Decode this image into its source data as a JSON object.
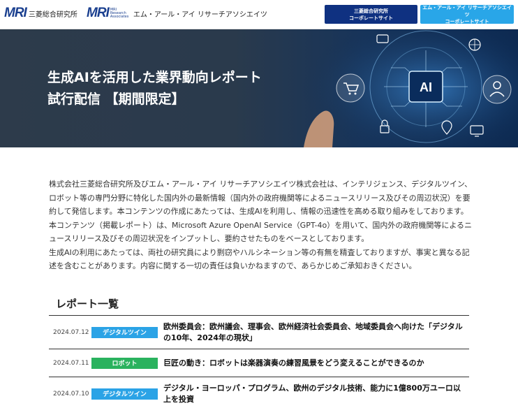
{
  "header": {
    "mri_logo": "MRI",
    "mri_name": "三菱総合研究所",
    "mra_logo": "MRI",
    "mra_sub": "MRI Research Associates",
    "mra_name": "エム・アール・アイ リサーチアソシエイツ",
    "buttons": [
      {
        "line1": "三菱総合研究所",
        "line2": "コーポレートサイト"
      },
      {
        "line1": "エム・アール・アイ リサーチアソシエイツ",
        "line2": "コーポレートサイト"
      }
    ],
    "colors": {
      "mri_blue": "#1a3f8f",
      "button_dark": "#0f3181",
      "button_light": "#29a6e8"
    }
  },
  "hero": {
    "title_line1": "生成AIを活用した業界動向レポート",
    "title_line2": "試行配信 【期間限定】",
    "ai_label": "AI",
    "icons": [
      "cart-icon",
      "person-icon",
      "lock-icon",
      "monitor-icon",
      "chat-icon",
      "location-pin-icon",
      "globe-icon"
    ]
  },
  "intro": {
    "paragraph1": "株式会社三菱総合研究所及びエム・アール・アイ リサーチアソシエイツ株式会社は、インテリジェンス、デジタルツイン、ロボット等の専門分野に特化した国内外の最新情報（国内外の政府機関等によるニュースリリース及びその周辺状況）を要約して発信します。本コンテンツの作成にあたっては、生成AIを利用し、情報の迅速性を高める取り組みをしております。",
    "paragraph2": "本コンテンツ（掲載レポート）は、Microsoft Azure OpenAI Service（GPT-4o）を用いて、国内外の政府機関等によるニュースリリース及びその周辺状況をインプットし、要約させたものをベースとしております。",
    "paragraph3": "生成AIの利用にあたっては、両社の研究員により剽窃やハルシネーション等の有無を精査しておりますが、事実と異なる記述を含むことがあります。内容に関する一切の責任は負いかねますので、あらかじめご承知おきください。"
  },
  "reports": {
    "title": "レポート一覧",
    "items": [
      {
        "date": "2024.07.12",
        "tag": "デジタルツイン",
        "tag_color": "#2ba3e6",
        "title": "欧州委員会：欧州議会、理事会、欧州経済社会委員会、地域委員会へ向けた「デジタルの10年、2024年の現状」"
      },
      {
        "date": "2024.07.11",
        "tag": "ロボット",
        "tag_color": "#2ab25e",
        "title": "巨匠の動き：ロボットは楽器演奏の練習風景をどう変えることができるのか"
      },
      {
        "date": "2024.07.10",
        "tag": "デジタルツイン",
        "tag_color": "#2ba3e6",
        "title": "デジタル・ヨーロッパ・プログラム、欧州のデジタル技術、能力に1億800万ユーロ以上を投資"
      }
    ]
  }
}
